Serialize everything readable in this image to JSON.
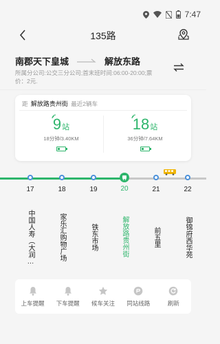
{
  "status_bar": {
    "time": "7:47"
  },
  "header": {
    "title": "135路"
  },
  "route": {
    "from": "南郡天下皇城",
    "to": "解放东路",
    "info": "所属分公司:公交三分公司;首末班时间:06:00-20:00;票价：2元."
  },
  "card": {
    "prefix": "距",
    "stop": "解放路贵州街",
    "suffix": "最近2辆车",
    "buses": [
      {
        "stops": "9",
        "unit": "站",
        "meta": "18分钟/3.40KM"
      },
      {
        "stops": "18",
        "unit": "站",
        "meta": "36分钟/7.64KM"
      }
    ]
  },
  "line": {
    "stops": [
      {
        "num": "17",
        "name": "中国人寿（大润…"
      },
      {
        "num": "18",
        "name": "家乐汇购物广场"
      },
      {
        "num": "19",
        "name": "铁东市场"
      },
      {
        "num": "20",
        "name": "解放路贵州街",
        "current": true
      },
      {
        "num": "21",
        "name": "前五里"
      },
      {
        "num": "22",
        "name": "御锦府西华苑"
      }
    ]
  },
  "bottom_actions": [
    {
      "label": "上车提醒",
      "icon": "bell-icon"
    },
    {
      "label": "下车提醒",
      "icon": "bell-icon"
    },
    {
      "label": "候车关注",
      "icon": "star-icon"
    },
    {
      "label": "同站线路",
      "icon": "route-icon"
    },
    {
      "label": "刷新",
      "icon": "refresh-icon"
    }
  ],
  "colors": {
    "accent": "#2db56b",
    "dot": "#4a90d9",
    "bus": "#f0b400"
  }
}
